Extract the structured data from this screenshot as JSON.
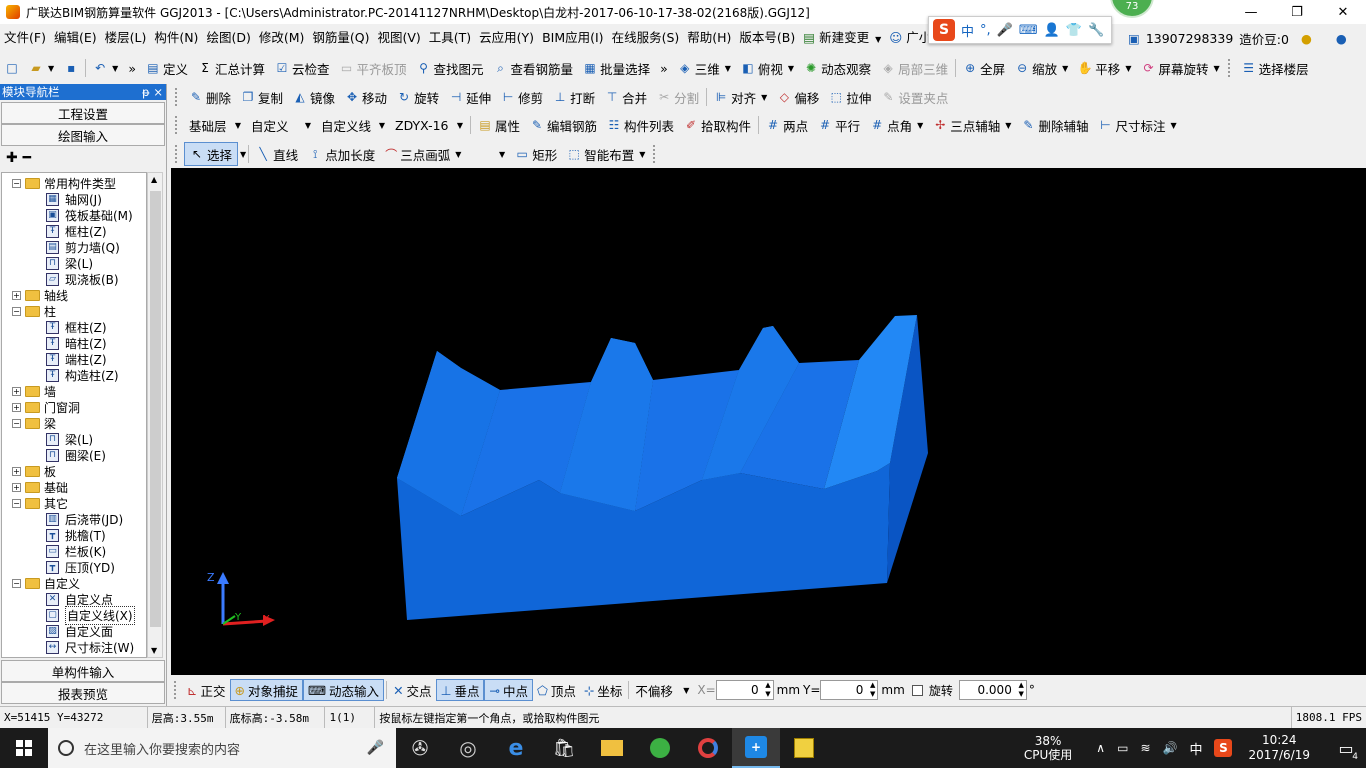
{
  "window": {
    "title": "广联达BIM钢筋算量软件 GGJ2013 - [C:\\Users\\Administrator.PC-20141127NRHM\\Desktop\\白龙村-2017-06-10-17-38-02(2168版).GGJ12]",
    "badge": "73",
    "minimize": "—",
    "maximize": "❐",
    "close": "✕"
  },
  "menu": [
    "文件(F)",
    "编辑(E)",
    "楼层(L)",
    "构件(N)",
    "绘图(D)",
    "修改(M)",
    "钢筋量(Q)",
    "视图(V)",
    "工具(T)",
    "云应用(Y)",
    "BIM应用(I)",
    "在线服务(S)",
    "帮助(H)",
    "版本号(B)",
    "新建变更",
    "广小二"
  ],
  "ime": {
    "logo": "S",
    "lang": "中"
  },
  "user": {
    "phone": "13907298339",
    "beans": "造价豆:0"
  },
  "toolbar1": [
    "定义",
    "汇总计算",
    "云检查",
    "平齐板顶",
    "查找图元",
    "查看钢筋量",
    "批量选择",
    "三维",
    "俯视",
    "动态观察",
    "局部三维",
    "全屏",
    "缩放",
    "平移",
    "屏幕旋转",
    "选择楼层"
  ],
  "toolbar2": [
    "删除",
    "复制",
    "镜像",
    "移动",
    "旋转",
    "延伸",
    "修剪",
    "打断",
    "合并",
    "分割",
    "对齐",
    "偏移",
    "拉伸",
    "设置夹点"
  ],
  "toolbar3": {
    "combos": [
      "基础层",
      "自定义",
      "自定义线",
      "ZDYX-16"
    ],
    "buttons": [
      "属性",
      "编辑钢筋",
      "构件列表",
      "拾取构件",
      "两点",
      "平行",
      "点角",
      "三点辅轴",
      "删除辅轴",
      "尺寸标注"
    ]
  },
  "toolbar4": [
    "选择",
    "直线",
    "点加长度",
    "三点画弧",
    "矩形",
    "智能布置"
  ],
  "sidebar": {
    "header": "模块导航栏",
    "pin": "ᵽ ×",
    "buttons": [
      "工程设置",
      "绘图输入"
    ],
    "bottom_buttons": [
      "单构件输入",
      "报表预览"
    ],
    "tree": [
      {
        "label": "常用构件类型",
        "level": 0,
        "type": "folder",
        "toggle": "−"
      },
      {
        "label": "轴网(J)",
        "level": 1,
        "type": "item",
        "icon": "▦"
      },
      {
        "label": "筏板基础(M)",
        "level": 1,
        "type": "item",
        "icon": "▣"
      },
      {
        "label": "框柱(Z)",
        "level": 1,
        "type": "item",
        "icon": "Ŧ"
      },
      {
        "label": "剪力墙(Q)",
        "level": 1,
        "type": "item",
        "icon": "▤"
      },
      {
        "label": "梁(L)",
        "level": 1,
        "type": "item",
        "icon": "⊓"
      },
      {
        "label": "现浇板(B)",
        "level": 1,
        "type": "item",
        "icon": "▱"
      },
      {
        "label": "轴线",
        "level": 0,
        "type": "folder",
        "toggle": "+"
      },
      {
        "label": "柱",
        "level": 0,
        "type": "folder",
        "toggle": "−"
      },
      {
        "label": "框柱(Z)",
        "level": 1,
        "type": "item",
        "icon": "Ŧ"
      },
      {
        "label": "暗柱(Z)",
        "level": 1,
        "type": "item",
        "icon": "Ŧ"
      },
      {
        "label": "端柱(Z)",
        "level": 1,
        "type": "item",
        "icon": "Ŧ"
      },
      {
        "label": "构造柱(Z)",
        "level": 1,
        "type": "item",
        "icon": "Ŧ"
      },
      {
        "label": "墙",
        "level": 0,
        "type": "folder",
        "toggle": "+"
      },
      {
        "label": "门窗洞",
        "level": 0,
        "type": "folder",
        "toggle": "+"
      },
      {
        "label": "梁",
        "level": 0,
        "type": "folder",
        "toggle": "−"
      },
      {
        "label": "梁(L)",
        "level": 1,
        "type": "item",
        "icon": "⊓"
      },
      {
        "label": "圈梁(E)",
        "level": 1,
        "type": "item",
        "icon": "⊓"
      },
      {
        "label": "板",
        "level": 0,
        "type": "folder",
        "toggle": "+"
      },
      {
        "label": "基础",
        "level": 0,
        "type": "folder",
        "toggle": "+"
      },
      {
        "label": "其它",
        "level": 0,
        "type": "folder",
        "toggle": "−"
      },
      {
        "label": "后浇带(JD)",
        "level": 1,
        "type": "item",
        "icon": "▥"
      },
      {
        "label": "挑檐(T)",
        "level": 1,
        "type": "item",
        "icon": "┳"
      },
      {
        "label": "栏板(K)",
        "level": 1,
        "type": "item",
        "icon": "▭"
      },
      {
        "label": "压顶(YD)",
        "level": 1,
        "type": "item",
        "icon": "┳"
      },
      {
        "label": "自定义",
        "level": 0,
        "type": "folder",
        "toggle": "−"
      },
      {
        "label": "自定义点",
        "level": 1,
        "type": "item",
        "icon": "✕"
      },
      {
        "label": "自定义线(X)",
        "level": 1,
        "type": "item",
        "icon": "▢",
        "selected": true
      },
      {
        "label": "自定义面",
        "level": 1,
        "type": "item",
        "icon": "▨"
      },
      {
        "label": "尺寸标注(W)",
        "level": 1,
        "type": "item",
        "icon": "↔"
      }
    ]
  },
  "snapbar": {
    "items": [
      "正交",
      "对象捕捉",
      "动态输入",
      "交点",
      "垂点",
      "中点",
      "顶点",
      "坐标"
    ],
    "offset_mode": "不偏移",
    "x_label": "X=",
    "x_value": "0",
    "y_label": "Y=",
    "y_value": "0",
    "unit": "mm",
    "rotate_label": "旋转",
    "rotate_value": "0.000",
    "degree": "°"
  },
  "status": {
    "coords": "X=51415 Y=43272",
    "floor_height": "层高:3.55m",
    "bottom_height": "底标高:-3.58m",
    "count": "1(1)",
    "hint": "按鼠标左键指定第一个角点，或拾取构件图元",
    "fps": "1808.1 FPS"
  },
  "taskbar": {
    "search_placeholder": "在这里输入你要搜索的内容",
    "cpu_percent": "38%",
    "cpu_label": "CPU使用",
    "ime": "中",
    "time": "10:24",
    "date": "2017/6/19",
    "notif_count": "4"
  },
  "colors": {
    "accent": "#1e6fd0",
    "model_top": "#1e7ff0",
    "model_front": "#1066d8",
    "model_side": "#0a4fb0"
  }
}
